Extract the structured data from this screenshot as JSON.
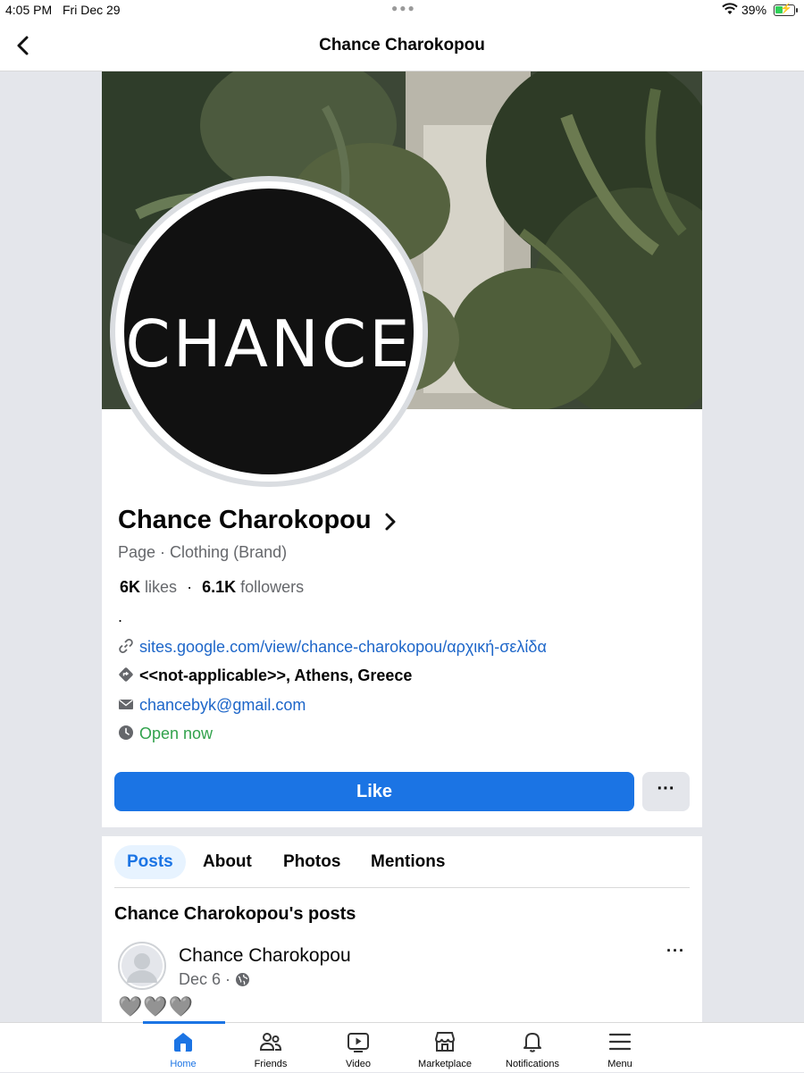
{
  "status_bar": {
    "time": "4:05 PM",
    "date": "Fri Dec 29",
    "battery_percent": "39%",
    "battery_level": 0.39
  },
  "header": {
    "title": "Chance Charokopou"
  },
  "profile": {
    "avatar_text": "CHANCE",
    "name": "Chance Charokopou",
    "category": "Page · Clothing (Brand)",
    "likes_count": "6K",
    "likes_label": "likes",
    "separator": "·",
    "followers_count": "6.1K",
    "followers_label": "followers",
    "intro": ".",
    "website": "sites.google.com/view/chance-charokopou/αρχική-σελίδα",
    "address": "<<not-applicable>>, Athens, Greece",
    "email": "chancebyk@gmail.com",
    "hours_status": "Open now",
    "like_button": "Like",
    "more_button": "···"
  },
  "tabs": [
    {
      "label": "Posts",
      "active": true
    },
    {
      "label": "About",
      "active": false
    },
    {
      "label": "Photos",
      "active": false
    },
    {
      "label": "Mentions",
      "active": false
    }
  ],
  "posts": {
    "heading": "Chance Charokopou's posts",
    "first_post": {
      "author": "Chance Charokopou",
      "date": "Dec 6 ·",
      "content": "🩶🩶🩶",
      "more": "···"
    }
  },
  "bottom_nav": [
    {
      "label": "Home",
      "icon": "home-icon",
      "active": true
    },
    {
      "label": "Friends",
      "icon": "friends-icon",
      "active": false
    },
    {
      "label": "Video",
      "icon": "video-icon",
      "active": false
    },
    {
      "label": "Marketplace",
      "icon": "marketplace-icon",
      "active": false
    },
    {
      "label": "Notifications",
      "icon": "bell-icon",
      "active": false
    },
    {
      "label": "Menu",
      "icon": "menu-icon",
      "active": false
    }
  ],
  "colors": {
    "accent": "#1b74e4",
    "link": "#1d66c9",
    "open_green": "#31a24c"
  }
}
